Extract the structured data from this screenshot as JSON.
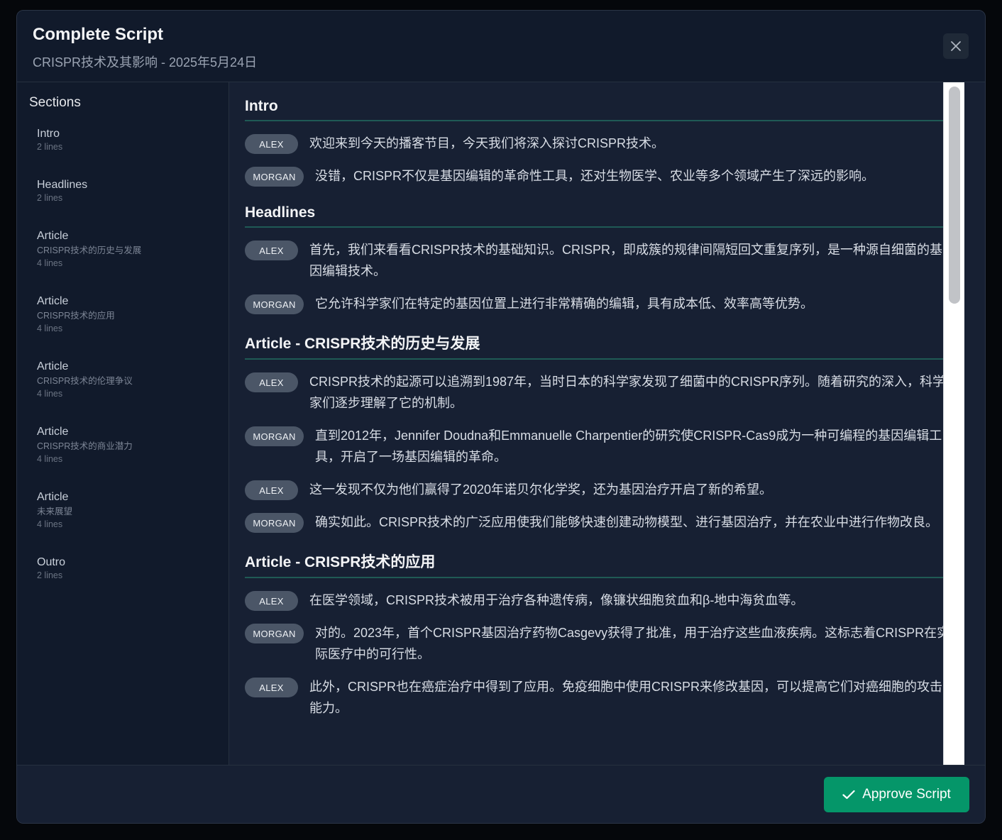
{
  "header": {
    "title": "Complete Script",
    "subtitle": "CRISPR技术及其影响 - 2025年5月24日",
    "close_icon": "close-icon"
  },
  "sidebar": {
    "heading": "Sections",
    "items": [
      {
        "name": "Intro",
        "desc": "",
        "count": "2 lines"
      },
      {
        "name": "Headlines",
        "desc": "",
        "count": "2 lines"
      },
      {
        "name": "Article",
        "desc": "CRISPR技术的历史与发展",
        "count": "4 lines"
      },
      {
        "name": "Article",
        "desc": "CRISPR技术的应用",
        "count": "4 lines"
      },
      {
        "name": "Article",
        "desc": "CRISPR技术的伦理争议",
        "count": "4 lines"
      },
      {
        "name": "Article",
        "desc": "CRISPR技术的商业潜力",
        "count": "4 lines"
      },
      {
        "name": "Article",
        "desc": "未来展望",
        "count": "4 lines"
      },
      {
        "name": "Outro",
        "desc": "",
        "count": "2 lines"
      }
    ]
  },
  "content": {
    "sections": [
      {
        "title": "Intro",
        "lines": [
          {
            "speaker": "ALEX",
            "text": "欢迎来到今天的播客节目，今天我们将深入探讨CRISPR技术。"
          },
          {
            "speaker": "MORGAN",
            "text": "没错，CRISPR不仅是基因编辑的革命性工具，还对生物医学、农业等多个领域产生了深远的影响。"
          }
        ]
      },
      {
        "title": "Headlines",
        "lines": [
          {
            "speaker": "ALEX",
            "text": "首先，我们来看看CRISPR技术的基础知识。CRISPR，即成簇的规律间隔短回文重复序列，是一种源自细菌的基因编辑技术。"
          },
          {
            "speaker": "MORGAN",
            "text": "它允许科学家们在特定的基因位置上进行非常精确的编辑，具有成本低、效率高等优势。"
          }
        ]
      },
      {
        "title": "Article - CRISPR技术的历史与发展",
        "lines": [
          {
            "speaker": "ALEX",
            "text": "CRISPR技术的起源可以追溯到1987年，当时日本的科学家发现了细菌中的CRISPR序列。随着研究的深入，科学家们逐步理解了它的机制。"
          },
          {
            "speaker": "MORGAN",
            "text": "直到2012年，Jennifer Doudna和Emmanuelle Charpentier的研究使CRISPR-Cas9成为一种可编程的基因编辑工具，开启了一场基因编辑的革命。"
          },
          {
            "speaker": "ALEX",
            "text": "这一发现不仅为他们赢得了2020年诺贝尔化学奖，还为基因治疗开启了新的希望。"
          },
          {
            "speaker": "MORGAN",
            "text": "确实如此。CRISPR技术的广泛应用使我们能够快速创建动物模型、进行基因治疗，并在农业中进行作物改良。"
          }
        ]
      },
      {
        "title": "Article - CRISPR技术的应用",
        "lines": [
          {
            "speaker": "ALEX",
            "text": "在医学领域，CRISPR技术被用于治疗各种遗传病，像镰状细胞贫血和β-地中海贫血等。"
          },
          {
            "speaker": "MORGAN",
            "text": "对的。2023年，首个CRISPR基因治疗药物Casgevy获得了批准，用于治疗这些血液疾病。这标志着CRISPR在实际医疗中的可行性。"
          },
          {
            "speaker": "ALEX",
            "text": "此外，CRISPR也在癌症治疗中得到了应用。免疫细胞中使用CRISPR来修改基因，可以提高它们对癌细胞的攻击能力。"
          }
        ]
      }
    ]
  },
  "footer": {
    "approve_label": "Approve Script",
    "approve_icon": "check-icon",
    "approve_color": "#059669"
  }
}
